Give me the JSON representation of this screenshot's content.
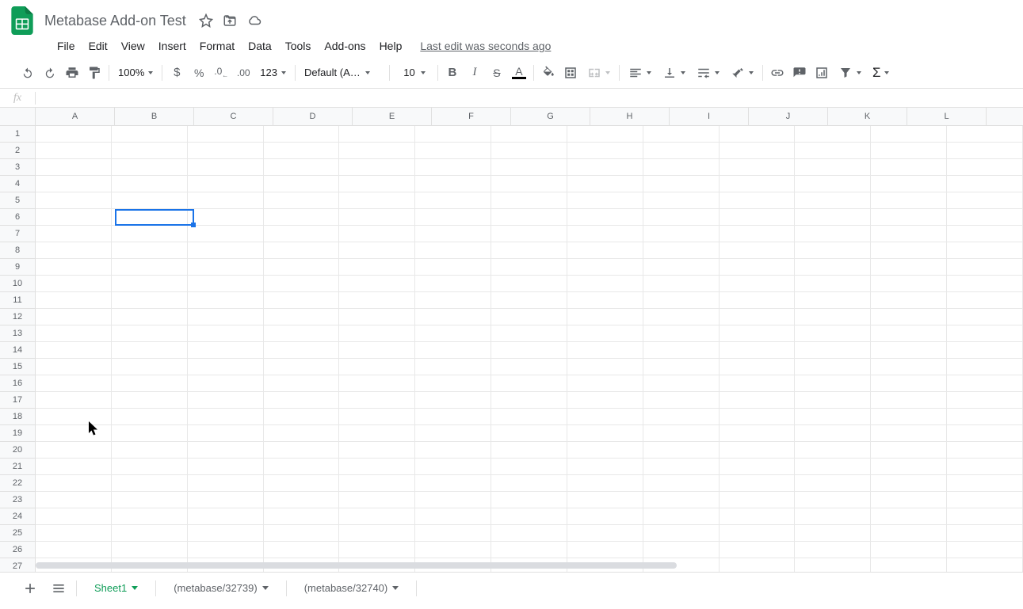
{
  "doc": {
    "title": "Metabase Add-on Test",
    "last_edit": "Last edit was seconds ago"
  },
  "menu": {
    "file": "File",
    "edit": "Edit",
    "view": "View",
    "insert": "Insert",
    "format": "Format",
    "data": "Data",
    "tools": "Tools",
    "addons": "Add-ons",
    "help": "Help"
  },
  "toolbar": {
    "zoom": "100%",
    "num_format": "123",
    "font_name": "Default (Ari...",
    "font_size": "10"
  },
  "formula": {
    "fx": "fx",
    "value": ""
  },
  "grid": {
    "columns": [
      "A",
      "B",
      "C",
      "D",
      "E",
      "F",
      "G",
      "H",
      "I",
      "J",
      "K",
      "L"
    ],
    "rows": [
      "1",
      "2",
      "3",
      "4",
      "5",
      "6",
      "7",
      "8",
      "9",
      "10",
      "11",
      "12",
      "13",
      "14",
      "15",
      "16",
      "17",
      "18",
      "19",
      "20",
      "21",
      "22",
      "23",
      "24",
      "25",
      "26",
      "27"
    ],
    "selected_cell": "B6"
  },
  "sheets": {
    "tab1": "Sheet1",
    "tab2": "(metabase/32739)",
    "tab3": "(metabase/32740)"
  }
}
